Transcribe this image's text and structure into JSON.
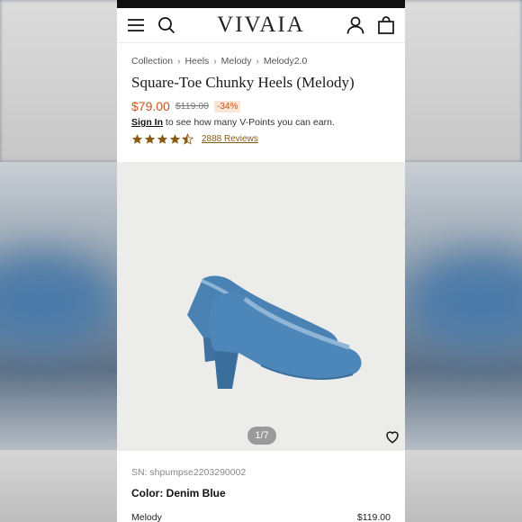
{
  "header": {
    "logo": "VIVAIA",
    "menu_icon": "hamburger-menu-icon",
    "search_icon": "search-icon",
    "account_icon": "account-icon",
    "cart_icon": "shopping-bag-icon"
  },
  "breadcrumb": [
    "Collection",
    "Heels",
    "Melody",
    "Melody2.0"
  ],
  "product": {
    "title": "Square-Toe Chunky Heels (Melody)",
    "price": "$79.00",
    "original_price": "$119.00",
    "discount": "-34%",
    "signin_link": "Sign In",
    "signin_text": " to see how many V-Points you can earn.",
    "rating": 4.5,
    "reviews_label": "2888 Reviews"
  },
  "gallery": {
    "counter": "1/7",
    "current": 1,
    "total": 7,
    "favorite_icon": "heart-icon"
  },
  "details": {
    "sn": "SN: shpumpse2203290002",
    "color_label": "Color: ",
    "color_value": "Denim Blue",
    "model_name": "Melody",
    "model_price": "$119.00"
  },
  "colors": {
    "accent": "#c8541a",
    "star": "#8a5a12",
    "shoe": "#4d86b8",
    "shoe_trim": "#8fb6d6"
  }
}
